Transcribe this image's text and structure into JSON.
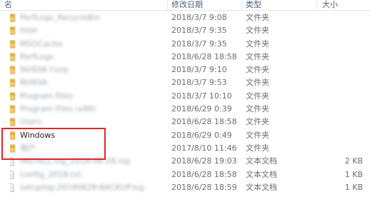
{
  "columns": {
    "name": "名",
    "modified": "修改日期",
    "type": "类型",
    "size": "大小"
  },
  "rows": [
    {
      "name": "PerfLogs_RecycleBin",
      "modified": "2018/3/7 9:08",
      "type": "文件夹",
      "size": "",
      "icon": "folder-icon",
      "blurred": true
    },
    {
      "name": "Intel",
      "modified": "2018/3/7 9:35",
      "type": "文件夹",
      "size": "",
      "icon": "folder-icon",
      "blurred": true
    },
    {
      "name": "MSOCache",
      "modified": "2018/3/7 9:35",
      "type": "文件夹",
      "size": "",
      "icon": "folder-icon",
      "blurred": true
    },
    {
      "name": "PerfLogs",
      "modified": "2018/6/28 18:58",
      "type": "文件夹",
      "size": "",
      "icon": "folder-icon",
      "blurred": true
    },
    {
      "name": "NVIDIA Corp",
      "modified": "2018/3/7 9:10",
      "type": "文件夹",
      "size": "",
      "icon": "folder-icon",
      "blurred": true
    },
    {
      "name": "NVIDIA",
      "modified": "2018/3/7 9:53",
      "type": "文件夹",
      "size": "",
      "icon": "folder-icon",
      "blurred": true
    },
    {
      "name": "Program Files",
      "modified": "2018/3/7 10:10",
      "type": "文件夹",
      "size": "",
      "icon": "folder-icon",
      "blurred": true
    },
    {
      "name": "Program Files (x86)",
      "modified": "2018/6/29 0:39",
      "type": "文件夹",
      "size": "",
      "icon": "folder-icon",
      "blurred": true
    },
    {
      "name": "Users",
      "modified": "2018/6/28 18:58",
      "type": "文件夹",
      "size": "",
      "icon": "folder-icon",
      "blurred": true
    },
    {
      "name": "Windows",
      "modified": "2018/6/29 0:49",
      "type": "文件夹",
      "size": "",
      "icon": "folder-icon",
      "blurred": false
    },
    {
      "name": "用户",
      "modified": "2017/8/10 11:46",
      "type": "文件夹",
      "size": "",
      "icon": "folder-icon",
      "blurred": true
    },
    {
      "name": "INSTALL.log_2018-06-28.log",
      "modified": "2018/6/28 19:03",
      "type": "文本文档",
      "size": "2 KB",
      "icon": "text-file-icon",
      "blurred": true
    },
    {
      "name": "config_2018.txt",
      "modified": "2018/6/28 18:58",
      "type": "文本文档",
      "size": "1 KB",
      "icon": "text-file-icon",
      "blurred": true
    },
    {
      "name": "setuplog-20180628-BACKUP.log",
      "modified": "2018/6/28 18:59",
      "type": "文本文档",
      "size": "1 KB",
      "icon": "text-file-icon",
      "blurred": true
    }
  ],
  "colors": {
    "highlight": "#e0262a",
    "folder": "#e8b84a",
    "header_text": "#4c607a"
  }
}
